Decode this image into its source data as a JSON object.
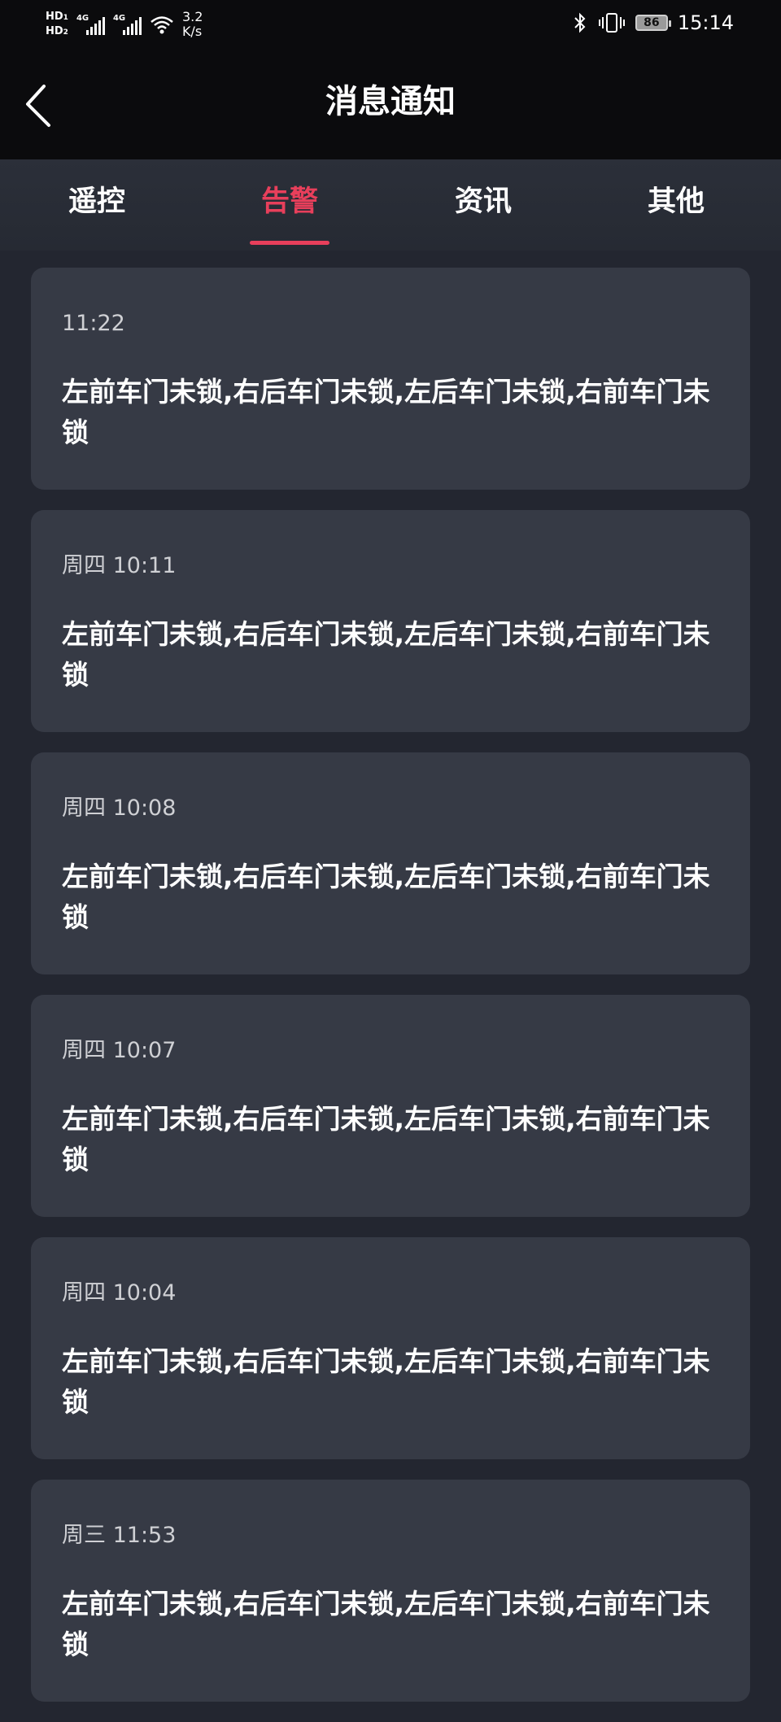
{
  "status_bar": {
    "hd1": "HD",
    "hd1_sub": "1",
    "hd2": "HD",
    "hd2_sub": "2",
    "net1": "4G",
    "net2": "4G",
    "speed_value": "3.2",
    "speed_unit": "K/s",
    "battery": "86",
    "time": "15:14"
  },
  "header": {
    "title": "消息通知"
  },
  "tabs": [
    {
      "label": "遥控"
    },
    {
      "label": "告警",
      "active": true
    },
    {
      "label": "资讯"
    },
    {
      "label": "其他"
    }
  ],
  "messages": [
    {
      "time": "11:22",
      "text": "左前车门未锁,右后车门未锁,左后车门未锁,右前车门未锁"
    },
    {
      "time": "周四 10:11",
      "text": "左前车门未锁,右后车门未锁,左后车门未锁,右前车门未锁"
    },
    {
      "time": "周四 10:08",
      "text": "左前车门未锁,右后车门未锁,左后车门未锁,右前车门未锁"
    },
    {
      "time": "周四 10:07",
      "text": "左前车门未锁,右后车门未锁,左后车门未锁,右前车门未锁"
    },
    {
      "time": "周四 10:04",
      "text": "左前车门未锁,右后车门未锁,左后车门未锁,右前车门未锁"
    },
    {
      "time": "周三 11:53",
      "text": "左前车门未锁,右后车门未锁,左后车门未锁,右前车门未锁"
    }
  ],
  "colors": {
    "accent": "#e83f5b",
    "card": "#363a45",
    "background": "#232630",
    "header": "#0b0b0d"
  }
}
